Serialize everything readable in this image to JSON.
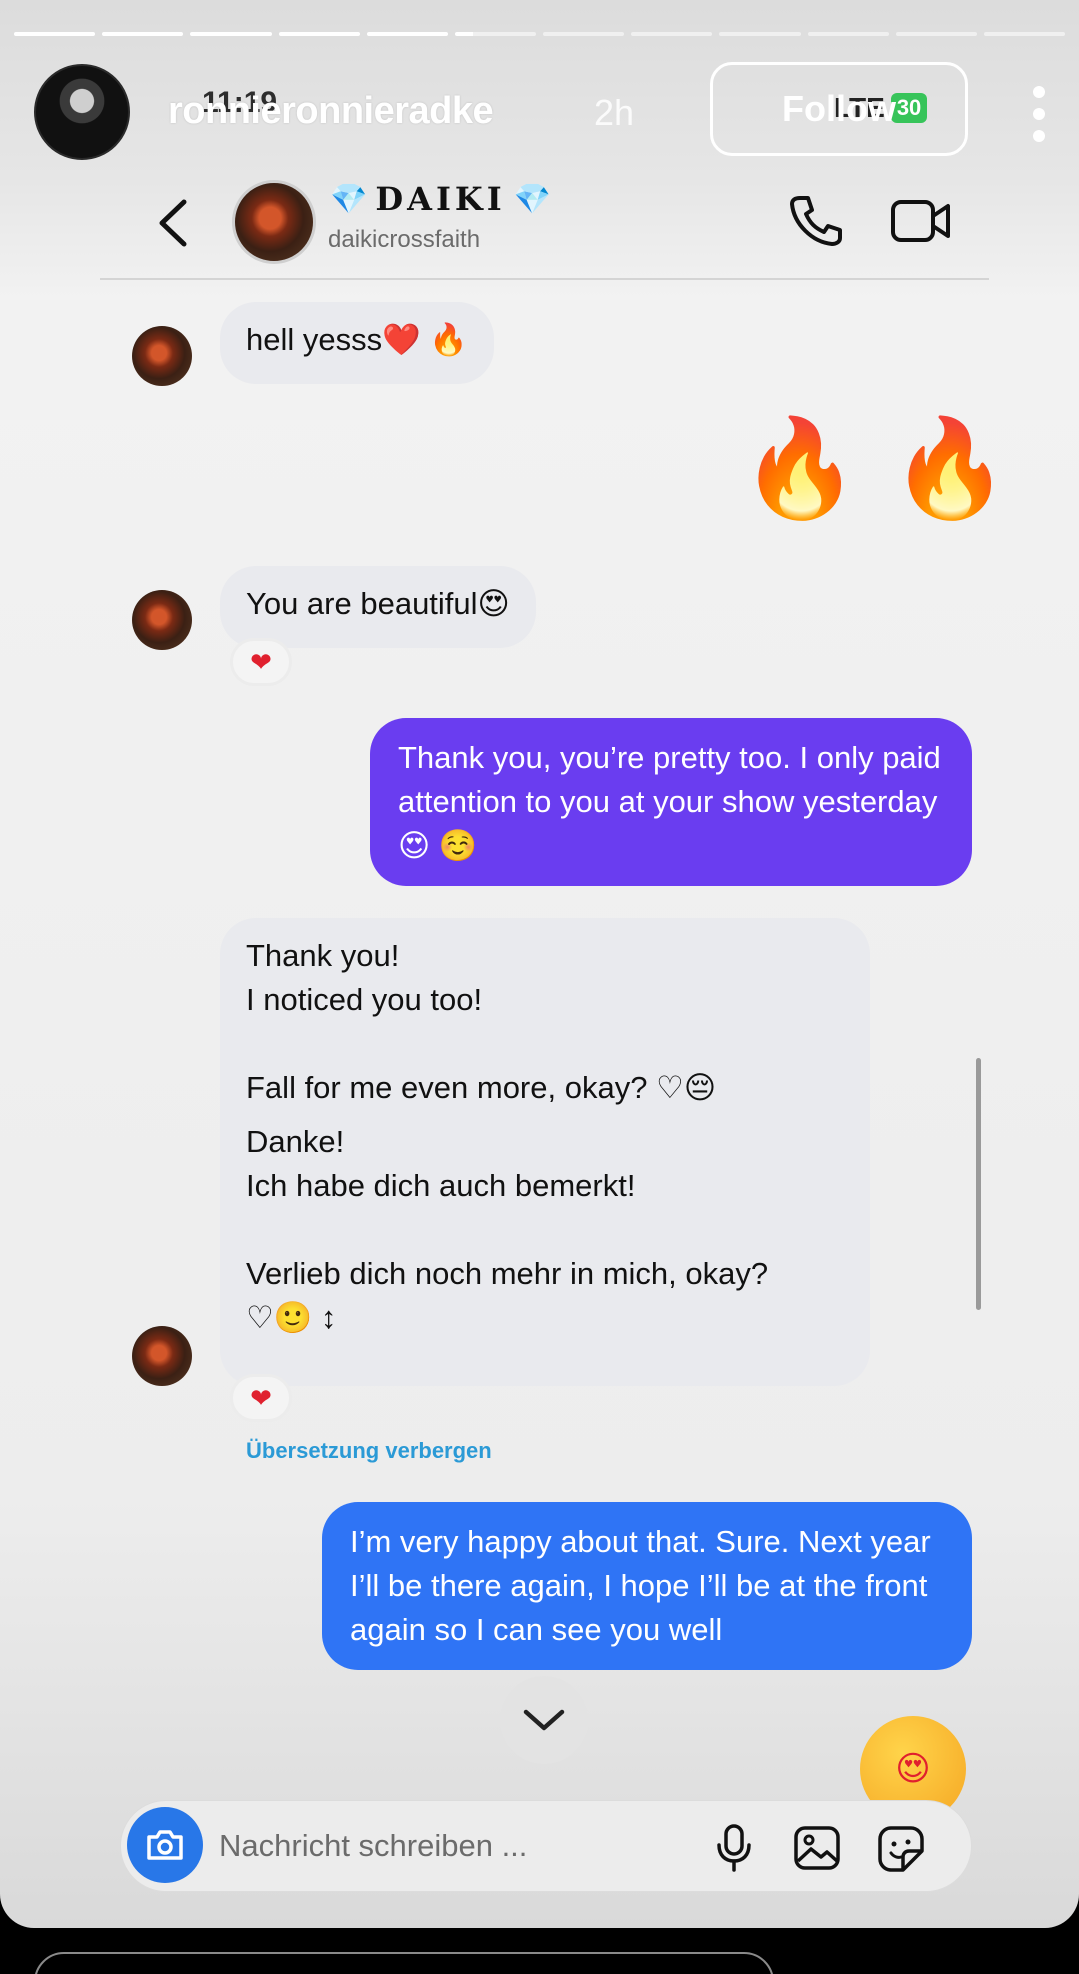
{
  "story": {
    "username": "ronnieronnieradke",
    "time_ago": "2h",
    "follow_label": "Follow",
    "progress": {
      "segments": 12,
      "active_index": 5
    },
    "status_bar": {
      "clock": "11:19",
      "network": "LTE",
      "battery": "30"
    }
  },
  "chat": {
    "name": "DAIKI",
    "name_decoration": "💎",
    "handle": "daikicrossfaith"
  },
  "messages": {
    "m1": "hell yesss❤️ 🔥",
    "m2_emojis": "🔥 🔥",
    "m3": "You are beautiful😍",
    "m3_reaction": "❤",
    "m4": "Thank you, you’re pretty too. I only paid attention to you at your show yesterday😍 ☺️",
    "m5_line1": "Thank you!",
    "m5_line2": "I noticed you too!",
    "m5_line3": "Fall for me even more, okay? ♡😔",
    "m5_trans1": "Danke!",
    "m5_trans2": "Ich habe dich auch bemerkt!",
    "m5_trans3": "Verlieb dich noch mehr in mich, okay?",
    "m5_trans4": "♡🙂 ↕",
    "m5_reaction": "❤",
    "hide_translation": "Übersetzung verbergen",
    "m6": "I’m very happy about that. Sure. Next year I’ll be there again, I hope I’ll be at the front again so I can see you well",
    "love_emoji": "😍"
  },
  "composer": {
    "placeholder": "Nachricht schreiben ..."
  },
  "colors": {
    "purple_bubble": "#6a3df0",
    "blue_bubble": "#2f74f5",
    "incoming_bubble": "#e9eaee",
    "link": "#2b9ad6"
  },
  "icons": [
    "back-icon",
    "call-icon",
    "video-icon",
    "more-icon",
    "camera-icon",
    "microphone-icon",
    "gallery-icon",
    "sticker-icon",
    "chevron-down-icon"
  ]
}
